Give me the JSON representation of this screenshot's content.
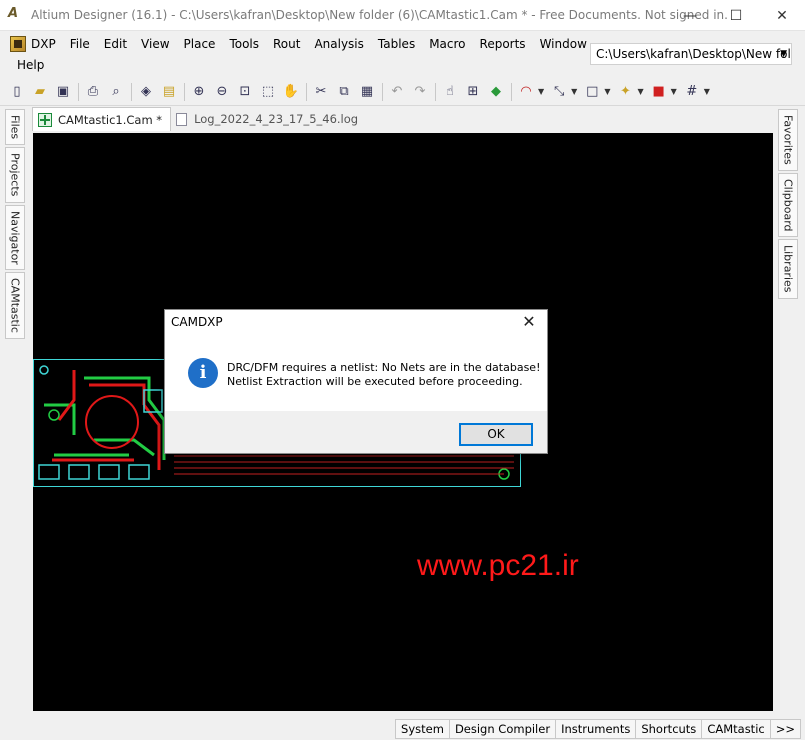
{
  "window": {
    "title": "Altium Designer (16.1) - C:\\Users\\kafran\\Desktop\\New folder (6)\\CAMtastic1.Cam * - Free Documents. Not signed in.",
    "minimize": "—",
    "maximize": "☐",
    "close": "✕"
  },
  "menu": {
    "row1": [
      "DXP",
      "File",
      "Edit",
      "View",
      "Place",
      "Tools",
      "Rout",
      "Analysis",
      "Tables",
      "Macro",
      "Reports",
      "Window"
    ],
    "row2": [
      "Help"
    ]
  },
  "path_combo": {
    "value": "C:\\Users\\kafran\\Desktop\\New fold"
  },
  "left_panels": [
    "Files",
    "Projects",
    "Navigator",
    "CAMtastic"
  ],
  "right_panels": [
    "Favorites",
    "Clipboard",
    "Libraries"
  ],
  "doc_tabs": [
    {
      "label": "CAMtastic1.Cam *",
      "active": true
    },
    {
      "label": "Log_2022_4_23_17_5_46.log",
      "active": false
    }
  ],
  "dialog": {
    "title": "CAMDXP",
    "close": "✕",
    "icon": "i",
    "line1": "DRC/DFM requires a netlist: No Nets are in the database!",
    "line2": "Netlist Extraction will be executed before proceeding.",
    "ok_label": "OK"
  },
  "watermark": "www.pc21.ir",
  "status_tabs": [
    "System",
    "Design Compiler",
    "Instruments",
    "Shortcuts",
    "CAMtastic",
    ">>"
  ],
  "colors": {
    "canvas": "#000000",
    "pcb_outline": "#3fd6d6",
    "trace_red": "#e01818",
    "trace_green": "#22cc44",
    "watermark": "#ff1a1a",
    "accent": "#0078d7"
  }
}
